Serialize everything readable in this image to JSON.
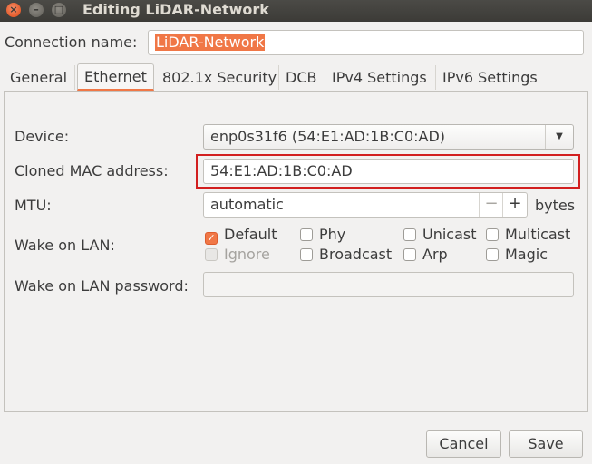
{
  "window": {
    "title": "Editing LiDAR-Network",
    "close_glyph": "×",
    "minimize_glyph": "–",
    "maximize_glyph": "□"
  },
  "connection": {
    "label": "Connection name:",
    "value": "LiDAR-Network"
  },
  "tabs": [
    {
      "label": "General"
    },
    {
      "label": "Ethernet"
    },
    {
      "label": "802.1x Security"
    },
    {
      "label": "DCB"
    },
    {
      "label": "IPv4 Settings"
    },
    {
      "label": "IPv6 Settings"
    }
  ],
  "active_tab": "Ethernet",
  "ethernet": {
    "device_label": "Device:",
    "device_value": "enp0s31f6 (54:E1:AD:1B:C0:AD)",
    "cloned_mac_label": "Cloned MAC address:",
    "cloned_mac_value": "54:E1:AD:1B:C0:AD",
    "mtu_label": "MTU:",
    "mtu_value": "automatic",
    "mtu_minus": "−",
    "mtu_plus": "+",
    "mtu_unit": "bytes",
    "wol_label": "Wake on LAN:",
    "wol_options": [
      {
        "label": "Default",
        "checked": true,
        "disabled": false
      },
      {
        "label": "Phy",
        "checked": false,
        "disabled": false
      },
      {
        "label": "Unicast",
        "checked": false,
        "disabled": false
      },
      {
        "label": "Multicast",
        "checked": false,
        "disabled": false
      },
      {
        "label": "Ignore",
        "checked": false,
        "disabled": true
      },
      {
        "label": "Broadcast",
        "checked": false,
        "disabled": false
      },
      {
        "label": "Arp",
        "checked": false,
        "disabled": false
      },
      {
        "label": "Magic",
        "checked": false,
        "disabled": false
      }
    ],
    "wol_password_label": "Wake on LAN password:",
    "wol_password_value": "",
    "check_glyph": "✓",
    "combo_arrow_glyph": "▼"
  },
  "buttons": {
    "cancel": "Cancel",
    "save": "Save"
  },
  "colors": {
    "accent": "#f07746",
    "highlight": "#d21f1f",
    "titlebar": "#3c3b37"
  }
}
